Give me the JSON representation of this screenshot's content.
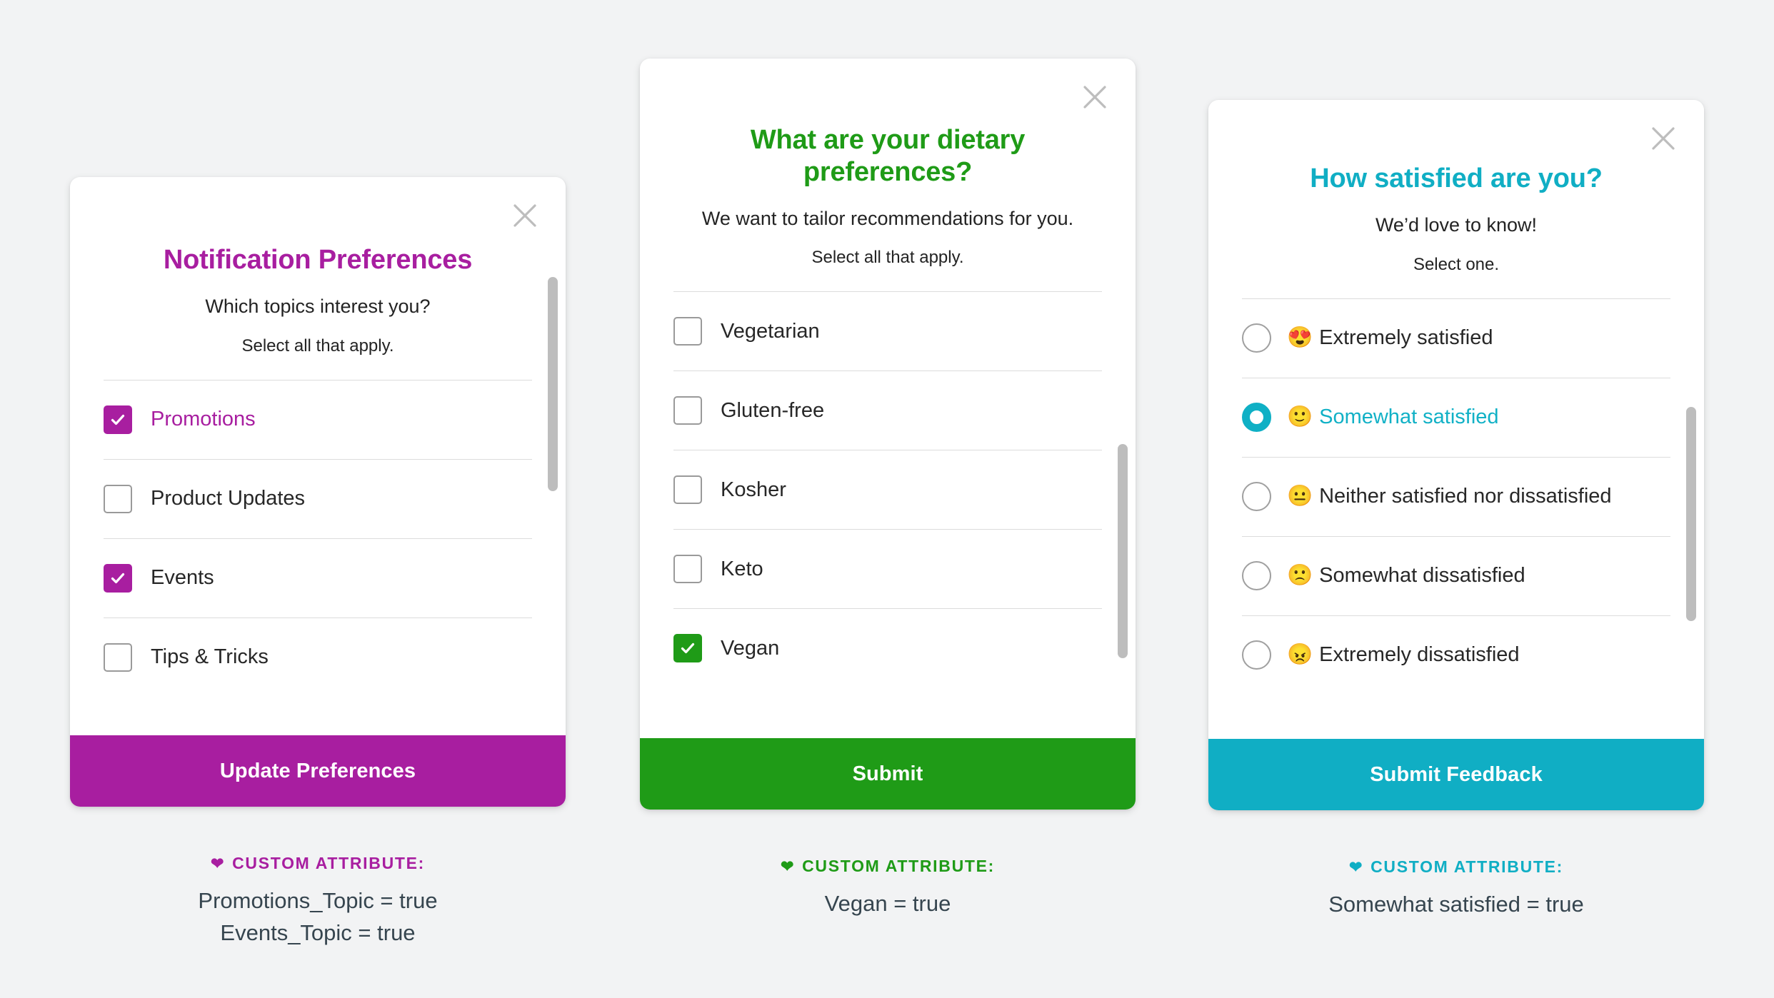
{
  "cards": [
    {
      "id": "notification-preferences",
      "accent": "#a81ea0",
      "title": "Notification Preferences",
      "subtitle": "Which topics interest you?",
      "hint": "Select all that apply.",
      "close_icon": "close-icon",
      "control_type": "checkbox",
      "options": [
        {
          "label": "Promotions",
          "checked": true,
          "emoji": ""
        },
        {
          "label": "Product Updates",
          "checked": false,
          "emoji": ""
        },
        {
          "label": "Events",
          "checked": true,
          "emoji": ""
        },
        {
          "label": "Tips & Tricks",
          "checked": false,
          "emoji": ""
        }
      ],
      "cta_label": "Update Preferences",
      "attribute": {
        "heart_icon": "heart-icon",
        "heading": "CUSTOM ATTRIBUTE:",
        "lines": [
          "Promotions_Topic = true",
          "Events_Topic = true"
        ]
      }
    },
    {
      "id": "dietary-preferences",
      "accent": "#1f9b17",
      "title": "What are your dietary preferences?",
      "subtitle": "We want to tailor recommendations for you.",
      "hint": "Select all that apply.",
      "close_icon": "close-icon",
      "control_type": "checkbox",
      "options": [
        {
          "label": "Vegetarian",
          "checked": false,
          "emoji": ""
        },
        {
          "label": "Gluten-free",
          "checked": false,
          "emoji": ""
        },
        {
          "label": "Kosher",
          "checked": false,
          "emoji": ""
        },
        {
          "label": "Keto",
          "checked": false,
          "emoji": ""
        },
        {
          "label": "Vegan",
          "checked": true,
          "emoji": ""
        }
      ],
      "cta_label": "Submit",
      "attribute": {
        "heart_icon": "heart-icon",
        "heading": "CUSTOM ATTRIBUTE:",
        "lines": [
          "Vegan = true"
        ]
      }
    },
    {
      "id": "satisfaction-survey",
      "accent": "#10aec4",
      "title": "How satisfied are you?",
      "subtitle": "We’d love to know!",
      "hint": "Select one.",
      "close_icon": "close-icon",
      "control_type": "radio",
      "options": [
        {
          "label": "Extremely satisfied",
          "checked": false,
          "emoji": "😍"
        },
        {
          "label": "Somewhat satisfied",
          "checked": true,
          "emoji": "🙂"
        },
        {
          "label": "Neither satisfied nor dissatisfied",
          "checked": false,
          "emoji": "😐"
        },
        {
          "label": "Somewhat dissatisfied",
          "checked": false,
          "emoji": "🙁"
        },
        {
          "label": "Extremely dissatisfied",
          "checked": false,
          "emoji": "😠"
        }
      ],
      "cta_label": "Submit Feedback",
      "attribute": {
        "heart_icon": "heart-icon",
        "heading": "CUSTOM ATTRIBUTE:",
        "lines": [
          "Somewhat satisfied = true"
        ]
      }
    }
  ]
}
